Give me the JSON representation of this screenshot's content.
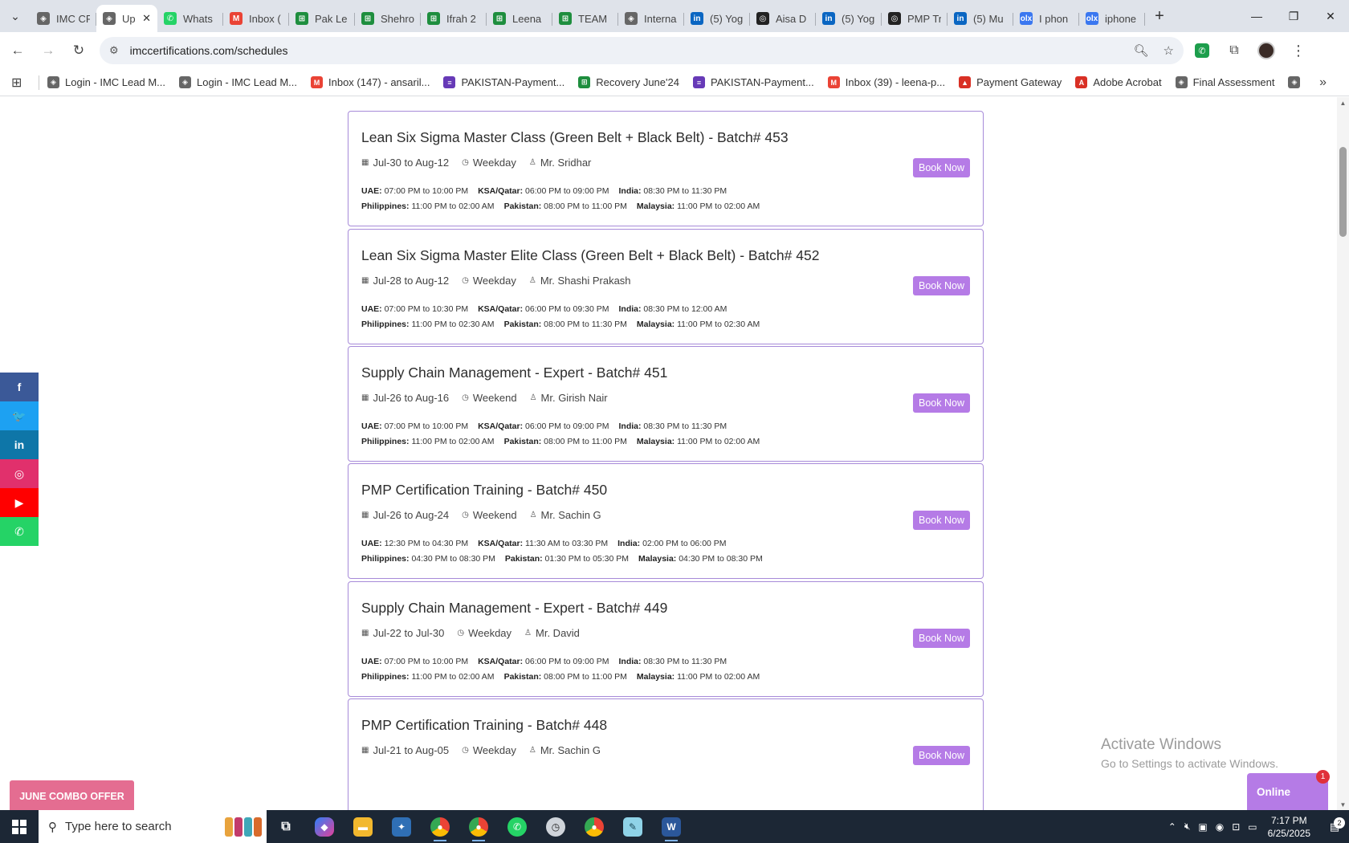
{
  "browser": {
    "tabs": [
      {
        "title": "IMC CR",
        "color": "#666666",
        "glyph": "◈"
      },
      {
        "title": "Up",
        "color": "#666666",
        "glyph": "◈",
        "active": true
      },
      {
        "title": "Whats",
        "color": "#25d366",
        "glyph": "✆"
      },
      {
        "title": "Inbox (",
        "color": "#ea4335",
        "glyph": "M"
      },
      {
        "title": "Pak Le",
        "color": "#1e8e3e",
        "glyph": "⊞"
      },
      {
        "title": "Shehro",
        "color": "#1e8e3e",
        "glyph": "⊞"
      },
      {
        "title": "Ifrah 2",
        "color": "#1e8e3e",
        "glyph": "⊞"
      },
      {
        "title": "Leena",
        "color": "#1e8e3e",
        "glyph": "⊞"
      },
      {
        "title": "TEAM",
        "color": "#1e8e3e",
        "glyph": "⊞"
      },
      {
        "title": "Interna",
        "color": "#666666",
        "glyph": "◈"
      },
      {
        "title": "(5) Yog",
        "color": "#0a66c2",
        "glyph": "in"
      },
      {
        "title": "Aisa D",
        "color": "#222222",
        "glyph": "◎"
      },
      {
        "title": "(5) Yog",
        "color": "#0a66c2",
        "glyph": "in"
      },
      {
        "title": "PMP Tr",
        "color": "#222222",
        "glyph": "◎"
      },
      {
        "title": "(5) Mu",
        "color": "#0a66c2",
        "glyph": "in"
      },
      {
        "title": "I phon",
        "color": "#3a77f0",
        "glyph": "olx"
      },
      {
        "title": "iphone",
        "color": "#3a77f0",
        "glyph": "olx"
      }
    ],
    "url": "imccertifications.com/schedules",
    "bookmarks": [
      {
        "label": "Login - IMC Lead M...",
        "color": "#666666",
        "glyph": "◈"
      },
      {
        "label": "Login - IMC Lead M...",
        "color": "#666666",
        "glyph": "◈"
      },
      {
        "label": "Inbox (147) - ansaril...",
        "color": "#ea4335",
        "glyph": "M"
      },
      {
        "label": "PAKISTAN-Payment...",
        "color": "#673ab7",
        "glyph": "≡"
      },
      {
        "label": "Recovery June'24",
        "color": "#1e8e3e",
        "glyph": "⊞"
      },
      {
        "label": "PAKISTAN-Payment...",
        "color": "#673ab7",
        "glyph": "≡"
      },
      {
        "label": "Inbox (39) - leena-p...",
        "color": "#ea4335",
        "glyph": "M"
      },
      {
        "label": "Payment Gateway",
        "color": "#d93025",
        "glyph": "▲"
      },
      {
        "label": "Adobe Acrobat",
        "color": "#d93025",
        "glyph": "A"
      },
      {
        "label": "Final Assessment",
        "color": "#666666",
        "glyph": "◈"
      }
    ]
  },
  "schedules": [
    {
      "title": "Lean Six Sigma Master Class (Green Belt + Black Belt) - Batch# 453",
      "dates": "Jul-30 to Aug-12",
      "mode": "Weekday",
      "trainer": "Mr. Sridhar",
      "row1": [
        {
          "k": "UAE:",
          "v": "07:00 PM to 10:00 PM"
        },
        {
          "k": "KSA/Qatar:",
          "v": "06:00 PM to 09:00 PM"
        },
        {
          "k": "India:",
          "v": "08:30 PM to 11:30 PM"
        }
      ],
      "row2": [
        {
          "k": "Philippines:",
          "v": "11:00 PM to 02:00 AM"
        },
        {
          "k": "Pakistan:",
          "v": "08:00 PM to 11:00 PM"
        },
        {
          "k": "Malaysia:",
          "v": "11:00 PM to 02:00 AM"
        }
      ],
      "button": "Book Now"
    },
    {
      "title": "Lean Six Sigma Master Elite Class (Green Belt + Black Belt) - Batch# 452",
      "dates": "Jul-28 to Aug-12",
      "mode": "Weekday",
      "trainer": "Mr. Shashi Prakash",
      "row1": [
        {
          "k": "UAE:",
          "v": "07:00 PM to 10:30 PM"
        },
        {
          "k": "KSA/Qatar:",
          "v": "06:00 PM to 09:30 PM"
        },
        {
          "k": "India:",
          "v": "08:30 PM to 12:00 AM"
        }
      ],
      "row2": [
        {
          "k": "Philippines:",
          "v": "11:00 PM to 02:30 AM"
        },
        {
          "k": "Pakistan:",
          "v": "08:00 PM to 11:30 PM"
        },
        {
          "k": "Malaysia:",
          "v": "11:00 PM to 02:30 AM"
        }
      ],
      "button": "Book Now"
    },
    {
      "title": "Supply Chain Management - Expert - Batch# 451",
      "dates": "Jul-26 to Aug-16",
      "mode": "Weekend",
      "trainer": "Mr. Girish Nair",
      "row1": [
        {
          "k": "UAE:",
          "v": "07:00 PM to 10:00 PM"
        },
        {
          "k": "KSA/Qatar:",
          "v": "06:00 PM to 09:00 PM"
        },
        {
          "k": "India:",
          "v": "08:30 PM to 11:30 PM"
        }
      ],
      "row2": [
        {
          "k": "Philippines:",
          "v": "11:00 PM to 02:00 AM"
        },
        {
          "k": "Pakistan:",
          "v": "08:00 PM to 11:00 PM"
        },
        {
          "k": "Malaysia:",
          "v": "11:00 PM to 02:00 AM"
        }
      ],
      "button": "Book Now"
    },
    {
      "title": "PMP Certification Training - Batch# 450",
      "dates": "Jul-26 to Aug-24",
      "mode": "Weekend",
      "trainer": "Mr. Sachin G",
      "row1": [
        {
          "k": "UAE:",
          "v": "12:30 PM to 04:30 PM"
        },
        {
          "k": "KSA/Qatar:",
          "v": "11:30 AM to 03:30 PM"
        },
        {
          "k": "India:",
          "v": "02:00 PM to 06:00 PM"
        }
      ],
      "row2": [
        {
          "k": "Philippines:",
          "v": "04:30 PM to 08:30 PM"
        },
        {
          "k": "Pakistan:",
          "v": "01:30 PM to 05:30 PM"
        },
        {
          "k": "Malaysia:",
          "v": "04:30 PM to 08:30 PM"
        }
      ],
      "button": "Book Now"
    },
    {
      "title": "Supply Chain Management - Expert - Batch# 449",
      "dates": "Jul-22 to Jul-30",
      "mode": "Weekday",
      "trainer": "Mr. David",
      "row1": [
        {
          "k": "UAE:",
          "v": "07:00 PM to 10:00 PM"
        },
        {
          "k": "KSA/Qatar:",
          "v": "06:00 PM to 09:00 PM"
        },
        {
          "k": "India:",
          "v": "08:30 PM to 11:30 PM"
        }
      ],
      "row2": [
        {
          "k": "Philippines:",
          "v": "11:00 PM to 02:00 AM"
        },
        {
          "k": "Pakistan:",
          "v": "08:00 PM to 11:00 PM"
        },
        {
          "k": "Malaysia:",
          "v": "11:00 PM to 02:00 AM"
        }
      ],
      "button": "Book Now"
    },
    {
      "title": "PMP Certification Training - Batch# 448",
      "dates": "Jul-21 to Aug-05",
      "mode": "Weekday",
      "trainer": "Mr. Sachin G",
      "row1": [],
      "row2": [],
      "button": "Book Now"
    }
  ],
  "social": [
    {
      "name": "facebook",
      "glyph": "f",
      "color": "#3b5998"
    },
    {
      "name": "twitter",
      "glyph": "🐦",
      "color": "#1da1f2"
    },
    {
      "name": "linkedin",
      "glyph": "in",
      "color": "#0e76a8"
    },
    {
      "name": "instagram",
      "glyph": "◎",
      "color": "#e1306c"
    },
    {
      "name": "youtube",
      "glyph": "▶",
      "color": "#ff0000"
    },
    {
      "name": "whatsapp",
      "glyph": "✆",
      "color": "#25d366"
    }
  ],
  "promo_label": "JUNE COMBO OFFER",
  "online": {
    "label": "Online",
    "badge": "1"
  },
  "activate": {
    "line1": "Activate Windows",
    "line2": "Go to Settings to activate Windows."
  },
  "taskbar": {
    "search_placeholder": "Type here to search",
    "time": "7:17 PM",
    "date": "6/25/2025"
  }
}
